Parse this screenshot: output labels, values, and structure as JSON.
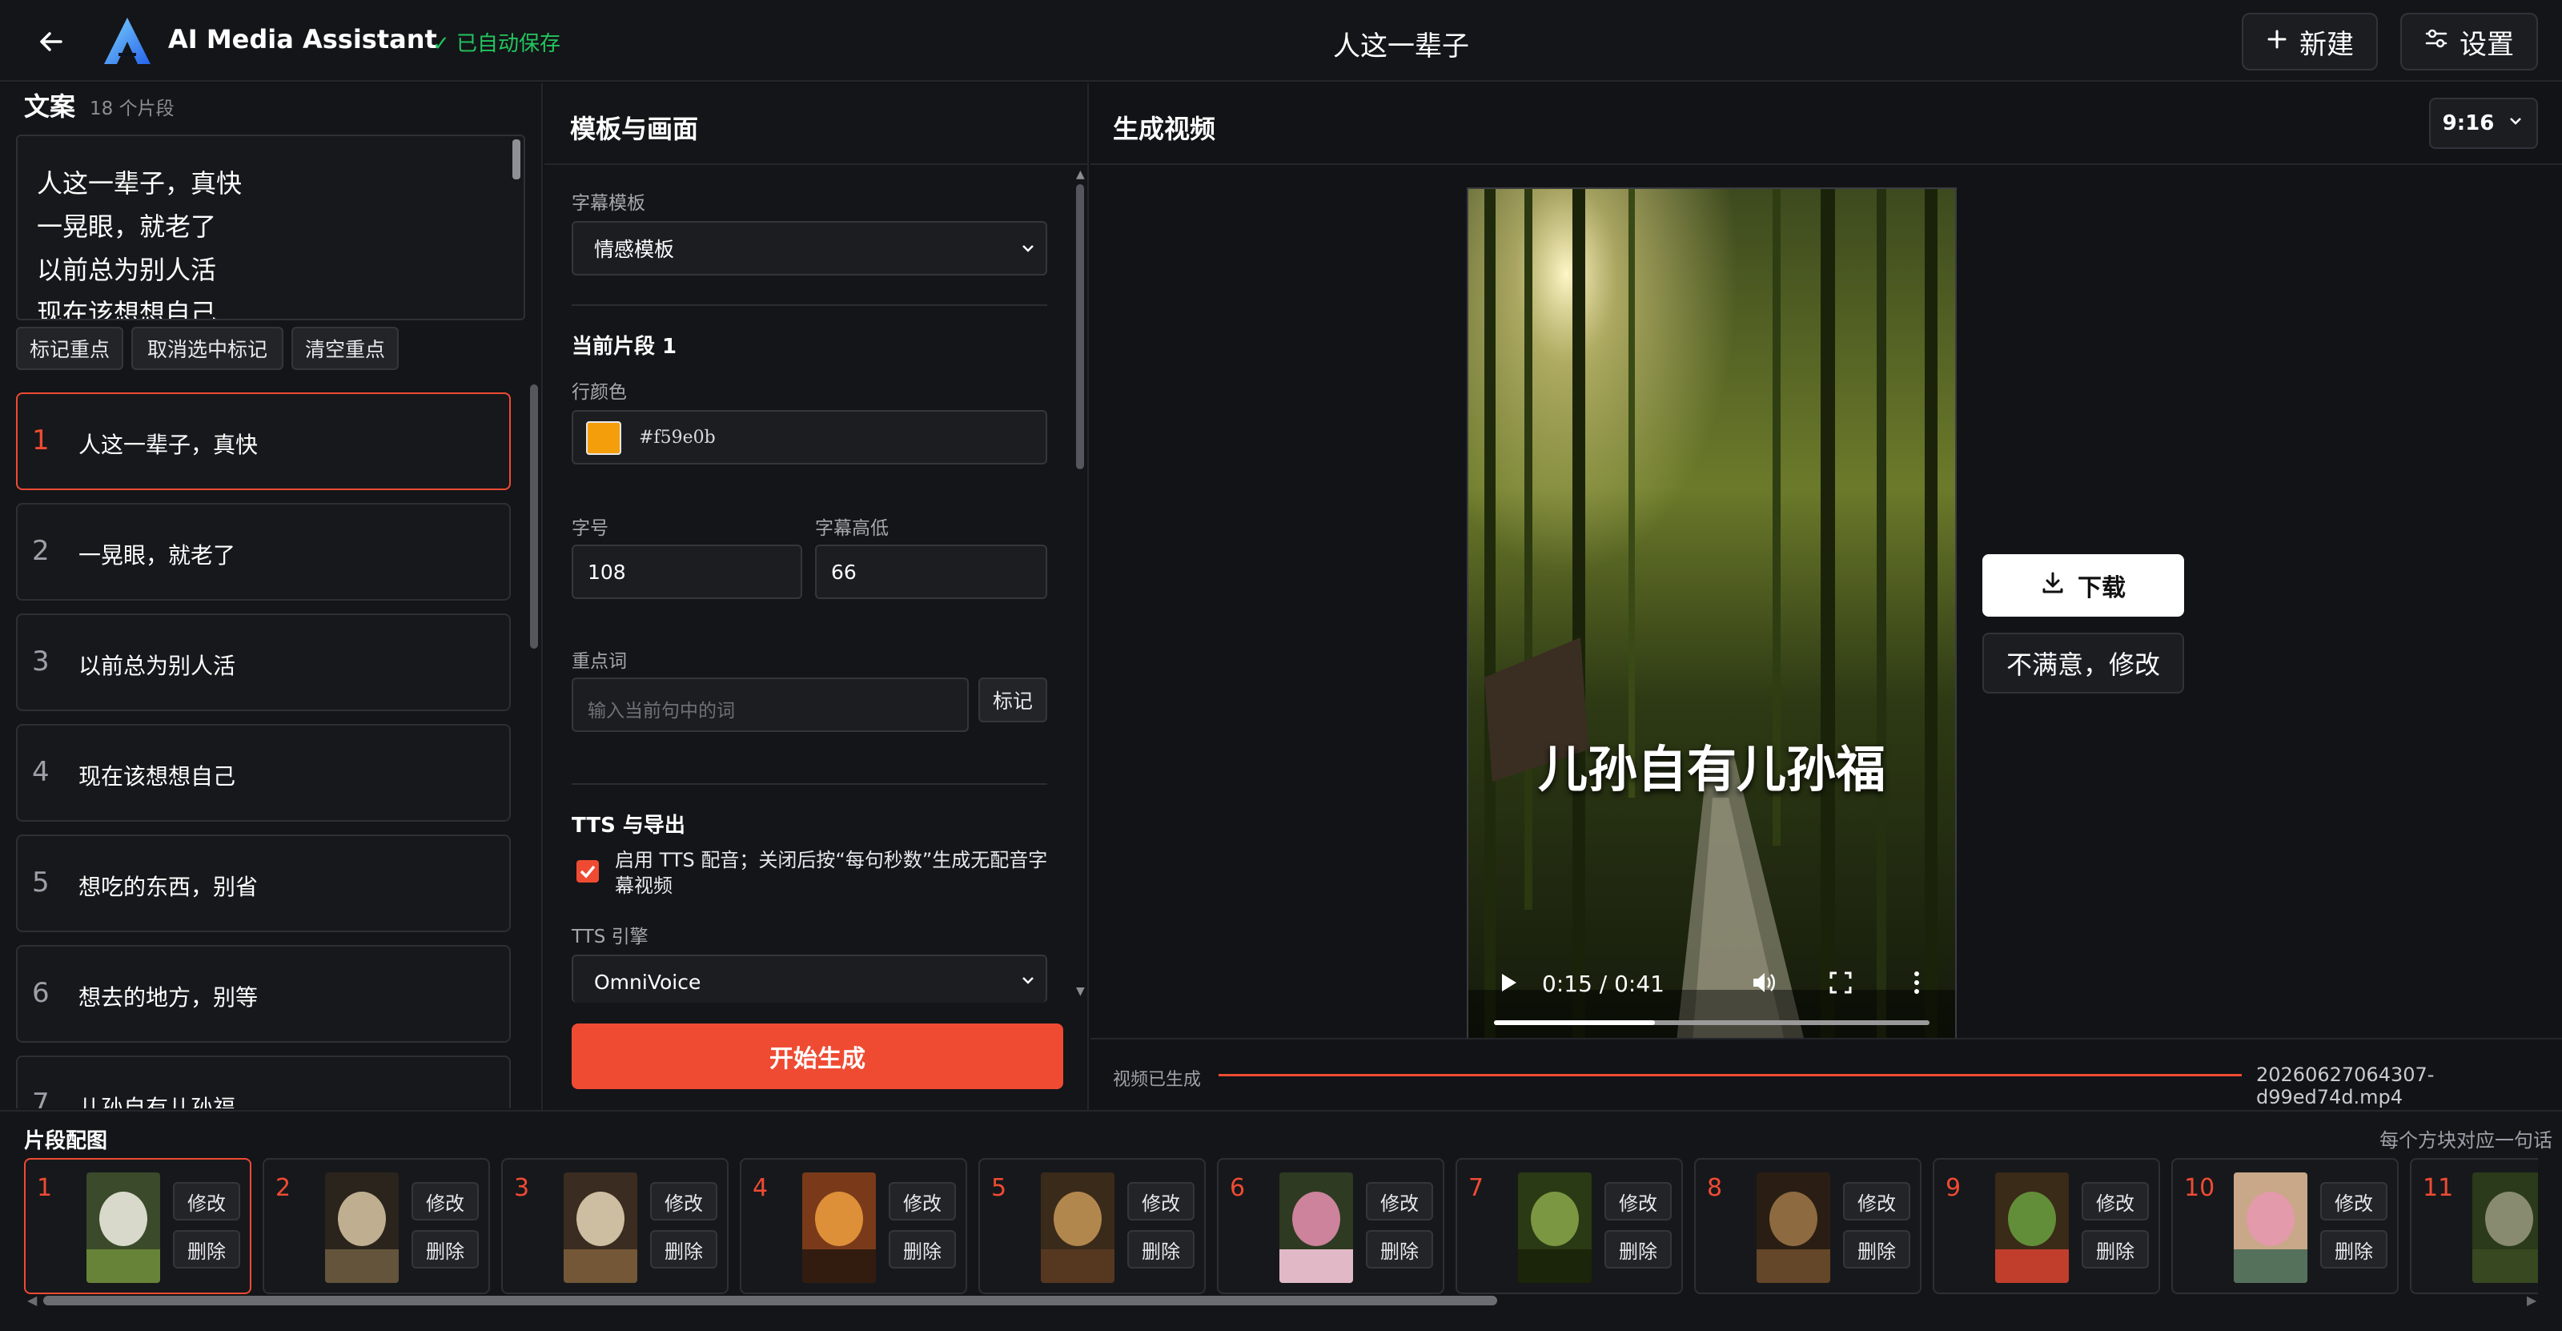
{
  "header": {
    "app_title": "AI Media Assistant",
    "save_status": "✓ 已自动保存",
    "doc_title": "人这一辈子",
    "new_label": "新建",
    "settings_label": "设置"
  },
  "script": {
    "title": "文案",
    "segment_count": "18 个片段",
    "lines": [
      "人这一辈子，真快",
      "一晃眼，就老了",
      "以前总为别人活",
      "现在该想想自己"
    ],
    "mark_label": "标记重点",
    "unmark_label": "取消选中标记",
    "clear_label": "清空重点"
  },
  "segments": [
    {
      "num": "1",
      "text": "人这一辈子，真快"
    },
    {
      "num": "2",
      "text": "一晃眼，就老了"
    },
    {
      "num": "3",
      "text": "以前总为别人活"
    },
    {
      "num": "4",
      "text": "现在该想想自己"
    },
    {
      "num": "5",
      "text": "想吃的东西，别省"
    },
    {
      "num": "6",
      "text": "想去的地方，别等"
    },
    {
      "num": "7",
      "text": "儿孙自有儿孙福"
    }
  ],
  "template_panel": {
    "title": "模板与画面",
    "subtitle_template_label": "字幕模板",
    "subtitle_template_value": "情感模板",
    "current_segment_title": "当前片段 1",
    "line_color_label": "行颜色",
    "line_color_value": "#f59e0b",
    "font_size_label": "字号",
    "font_size_value": "108",
    "subtitle_height_label": "字幕高低",
    "subtitle_height_value": "66",
    "keyword_label": "重点词",
    "keyword_placeholder": "输入当前句中的词",
    "keyword_mark_label": "标记",
    "tts_title": "TTS 与导出",
    "tts_checkbox_label": "启用 TTS 配音；关闭后按“每句秒数”生成无配音字幕视频",
    "tts_engine_label": "TTS 引擎",
    "tts_engine_value": "OmniVoice",
    "start_label": "开始生成"
  },
  "video_panel": {
    "title": "生成视频",
    "ratio": "9:16",
    "caption": "儿孙自有儿孙福",
    "time": "0:15 / 0:41",
    "progress": 0.37,
    "download_label": "下载",
    "modify_label": "不满意，修改",
    "status": "视频已生成",
    "file_name": "20260627064307-d99ed74d.mp4"
  },
  "strip": {
    "title": "片段配图",
    "hint": "每个方块对应一句话",
    "edit_label": "修改",
    "delete_label": "删除",
    "cards": [
      {
        "num": "1",
        "image": "lily-flowers-image"
      },
      {
        "num": "2",
        "image": "window-desk-image"
      },
      {
        "num": "3",
        "image": "open-book-image"
      },
      {
        "num": "4",
        "image": "sunset-path-image"
      },
      {
        "num": "5",
        "image": "armchair-room-image"
      },
      {
        "num": "6",
        "image": "peony-flowers-image"
      },
      {
        "num": "7",
        "image": "bamboo-forest-image"
      },
      {
        "num": "8",
        "image": "teapot-image"
      },
      {
        "num": "9",
        "image": "vegetable-basket-image"
      },
      {
        "num": "10",
        "image": "lotus-pond-image"
      },
      {
        "num": "11",
        "image": "bamboo-path-image"
      }
    ]
  },
  "colors": {
    "accent": "#ef4b33",
    "success": "#22c55e",
    "line_color_swatch": "#f59e0b"
  }
}
